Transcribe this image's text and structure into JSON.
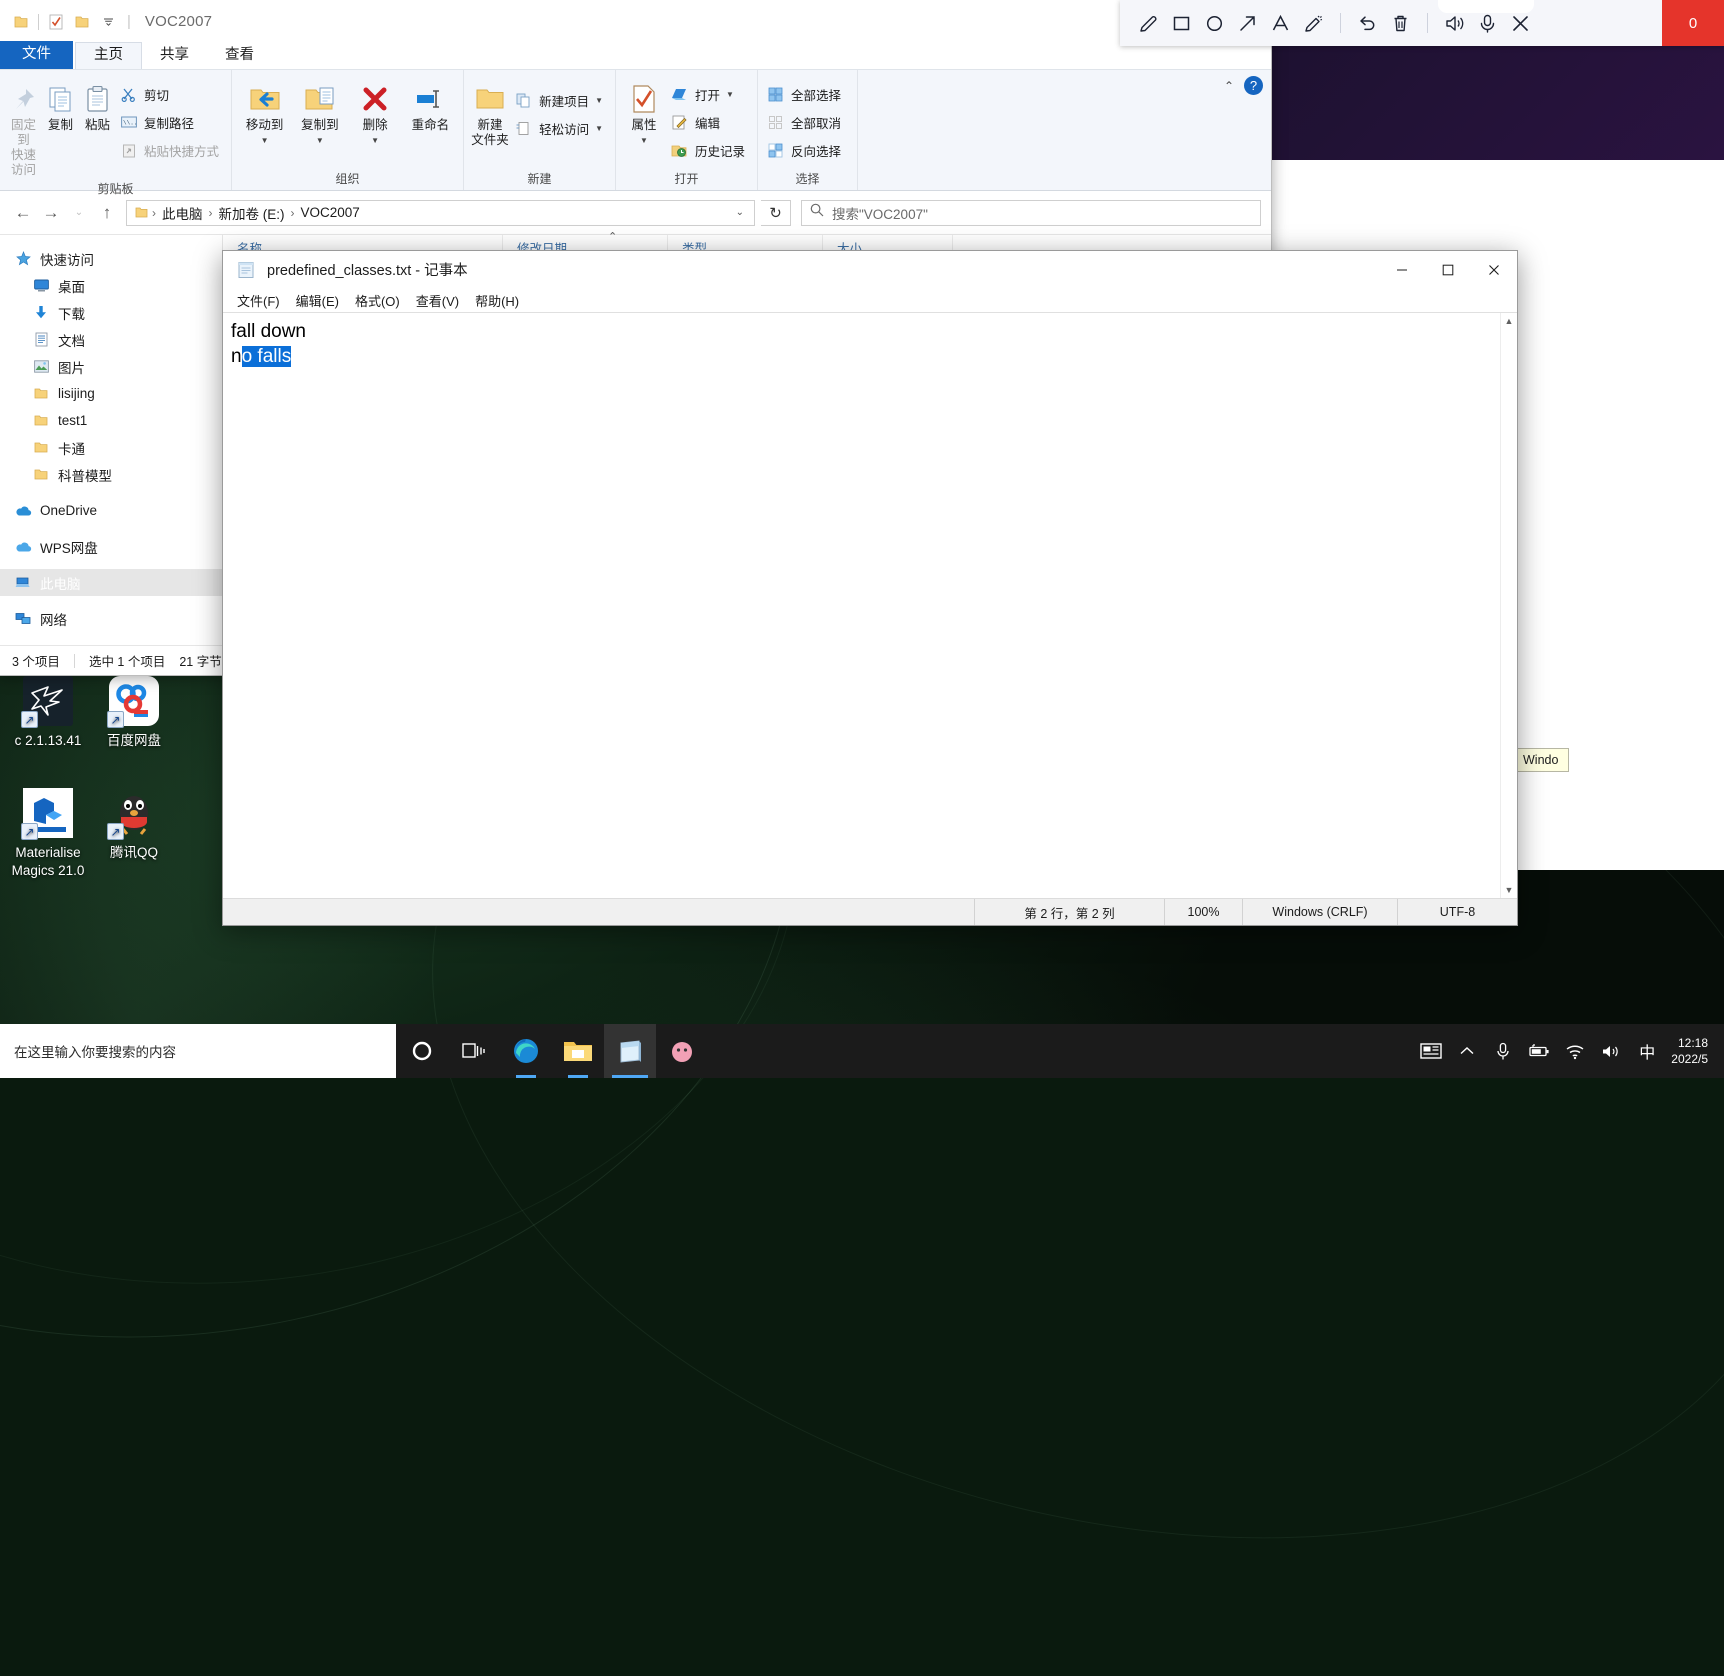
{
  "explorer": {
    "title": "VOC2007",
    "tabs": [
      {
        "label": "文件",
        "kind": "file"
      },
      {
        "label": "主页",
        "kind": "active"
      },
      {
        "label": "共享",
        "kind": "normal"
      },
      {
        "label": "查看",
        "kind": "normal"
      }
    ],
    "ribbon_groups": [
      {
        "label": "剪贴板",
        "big": [
          {
            "label": "固定到\n快速访问",
            "icon": "pin-icon",
            "disabled": true
          },
          {
            "label": "复制",
            "icon": "copy-icon",
            "disabled": false
          },
          {
            "label": "粘贴",
            "icon": "paste-icon",
            "disabled": false
          }
        ],
        "small": [
          {
            "label": "剪切",
            "icon": "scissors-icon",
            "disabled": false
          },
          {
            "label": "复制路径",
            "icon": "copy-path-icon",
            "disabled": false
          },
          {
            "label": "粘贴快捷方式",
            "icon": "paste-shortcut-icon",
            "disabled": true
          }
        ]
      },
      {
        "label": "组织",
        "big": [
          {
            "label": "移动到",
            "icon": "move-to-icon",
            "dropdown": true
          },
          {
            "label": "复制到",
            "icon": "copy-to-icon",
            "dropdown": true
          },
          {
            "label": "删除",
            "icon": "delete-icon",
            "dropdown": true
          },
          {
            "label": "重命名",
            "icon": "rename-icon",
            "dropdown": false
          }
        ],
        "small": []
      },
      {
        "label": "新建",
        "big": [
          {
            "label": "新建\n文件夹",
            "icon": "new-folder-icon",
            "disabled": false
          }
        ],
        "small": [
          {
            "label": "新建项目",
            "icon": "new-item-icon",
            "dropdown": true
          },
          {
            "label": "轻松访问",
            "icon": "easy-access-icon",
            "dropdown": true
          }
        ]
      },
      {
        "label": "打开",
        "big": [
          {
            "label": "属性",
            "icon": "properties-icon",
            "dropdown": true
          }
        ],
        "small": [
          {
            "label": "打开",
            "icon": "open-icon",
            "dropdown": true
          },
          {
            "label": "编辑",
            "icon": "edit-icon",
            "dropdown": false
          },
          {
            "label": "历史记录",
            "icon": "history-icon",
            "dropdown": false
          }
        ]
      },
      {
        "label": "选择",
        "big": [],
        "small": [
          {
            "label": "全部选择",
            "icon": "select-all-icon"
          },
          {
            "label": "全部取消",
            "icon": "select-none-icon"
          },
          {
            "label": "反向选择",
            "icon": "invert-selection-icon"
          }
        ]
      }
    ],
    "breadcrumb": [
      "此电脑",
      "新加卷 (E:)",
      "VOC2007"
    ],
    "search_placeholder": "搜索\"VOC2007\"",
    "nav_pane": [
      {
        "label": "快速访问",
        "icon": "star-icon",
        "indent": false,
        "selected": false
      },
      {
        "label": "桌面",
        "icon": "desktop-icon",
        "indent": true,
        "selected": false
      },
      {
        "label": "下载",
        "icon": "download-icon",
        "indent": true,
        "selected": false
      },
      {
        "label": "文档",
        "icon": "documents-icon",
        "indent": true,
        "selected": false
      },
      {
        "label": "图片",
        "icon": "pictures-icon",
        "indent": true,
        "selected": false
      },
      {
        "label": "lisijing",
        "icon": "folder-icon",
        "indent": true,
        "selected": false
      },
      {
        "label": "test1",
        "icon": "folder-icon",
        "indent": true,
        "selected": false
      },
      {
        "label": "卡通",
        "icon": "folder-icon",
        "indent": true,
        "selected": false
      },
      {
        "label": "科普模型",
        "icon": "folder-icon",
        "indent": true,
        "selected": false
      },
      {
        "label": "OneDrive",
        "icon": "onedrive-icon",
        "indent": false,
        "selected": false,
        "gap_before": true
      },
      {
        "label": "WPS网盘",
        "icon": "wps-cloud-icon",
        "indent": false,
        "selected": false,
        "gap_before": true
      },
      {
        "label": "此电脑",
        "icon": "this-pc-icon",
        "indent": false,
        "selected": true,
        "gap_before": true
      },
      {
        "label": "网络",
        "icon": "network-icon",
        "indent": false,
        "selected": false,
        "gap_before": true
      }
    ],
    "columns": [
      "名称",
      "修改日期",
      "类型",
      "大小"
    ],
    "status": {
      "items_count": "3 个项目",
      "selection": "选中 1 个项目",
      "size": "21 字节"
    }
  },
  "notepad": {
    "title": "predefined_classes.txt - 记事本",
    "menu": [
      "文件(F)",
      "编辑(E)",
      "格式(O)",
      "查看(V)",
      "帮助(H)"
    ],
    "window_buttons": {
      "minimize": "—",
      "maximize": "▢",
      "close": "✕"
    },
    "content": {
      "line1": "fall down",
      "line2_prefix": "n",
      "line2_selected": "o falls"
    },
    "status": {
      "position": "第 2 行，第 2 列",
      "zoom": "100%",
      "line_ending": "Windows (CRLF)",
      "encoding": "UTF-8"
    }
  },
  "annotation_toolbar": {
    "tools": [
      {
        "name": "pen-icon",
        "label": "画笔"
      },
      {
        "name": "rectangle-icon",
        "label": "矩形"
      },
      {
        "name": "ellipse-icon",
        "label": "椭圆"
      },
      {
        "name": "arrow-icon",
        "label": "箭头"
      },
      {
        "name": "text-icon",
        "label": "文字"
      },
      {
        "name": "highlighter-icon",
        "label": "荧光笔"
      }
    ],
    "actions": [
      {
        "name": "undo-icon",
        "label": "撤销"
      },
      {
        "name": "trash-icon",
        "label": "清空"
      }
    ],
    "media": [
      {
        "name": "speaker-icon",
        "label": "扬声器"
      },
      {
        "name": "microphone-icon",
        "label": "麦克风"
      },
      {
        "name": "close-icon",
        "label": "关闭"
      }
    ],
    "record_label": "0"
  },
  "desktop_icons": [
    {
      "label": "c 2.1.13.41",
      "icon": "hummingbird-icon"
    },
    {
      "label": "百度网盘",
      "icon": "baidu-netdisk-icon"
    },
    {
      "label": "Materialise\nMagics 21.0",
      "icon": "materialise-magics-icon"
    },
    {
      "label": "腾讯QQ",
      "icon": "tencent-qq-icon"
    }
  ],
  "background_tooltip": "Windo",
  "taskbar": {
    "search_placeholder": "在这里输入你要搜索的内容",
    "buttons": [
      {
        "name": "cortana-icon",
        "label": "Cortana"
      },
      {
        "name": "task-view-icon",
        "label": "任务视图"
      },
      {
        "name": "edge-icon",
        "label": "Microsoft Edge"
      },
      {
        "name": "file-explorer-icon",
        "label": "文件资源管理器"
      },
      {
        "name": "notepad-icon",
        "label": "记事本"
      },
      {
        "name": "app-icon",
        "label": "应用"
      }
    ],
    "tray": [
      {
        "name": "news-icon",
        "label": "新闻和兴趣"
      },
      {
        "name": "chevron-up-icon",
        "label": "显示隐藏的图标"
      },
      {
        "name": "microphone-icon",
        "label": "麦克风"
      },
      {
        "name": "battery-icon",
        "label": "电池"
      },
      {
        "name": "wifi-icon",
        "label": "网络"
      },
      {
        "name": "volume-icon",
        "label": "音量"
      },
      {
        "name": "ime-icon",
        "label": "中"
      }
    ],
    "clock": {
      "time": "12:18",
      "date": "2022/5"
    }
  }
}
